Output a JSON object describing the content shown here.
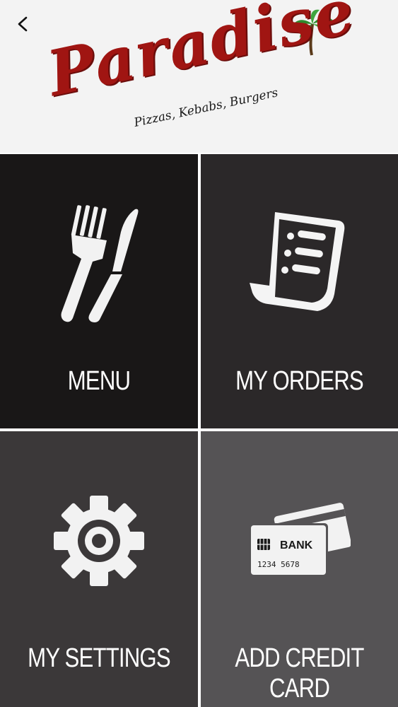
{
  "header": {
    "back_icon": "chevron-left-icon",
    "brand_name": "Paradise",
    "tagline": "Pizzas, Kebabs, Burgers"
  },
  "tiles": [
    {
      "label": "MENU",
      "icon": "fork-knife-icon"
    },
    {
      "label": "MY ORDERS",
      "icon": "receipt-icon"
    },
    {
      "label": "MY SETTINGS",
      "icon": "gear-icon"
    },
    {
      "label": "ADD CREDIT CARD",
      "icon": "credit-card-icon"
    }
  ],
  "credit_card": {
    "bank_text": "BANK",
    "number_text": "1234 5678"
  },
  "colors": {
    "brand_red": "#a01512",
    "tile_1": "#191717",
    "tile_2": "#2b2829",
    "tile_3": "#3b3839",
    "tile_4": "#555355"
  }
}
